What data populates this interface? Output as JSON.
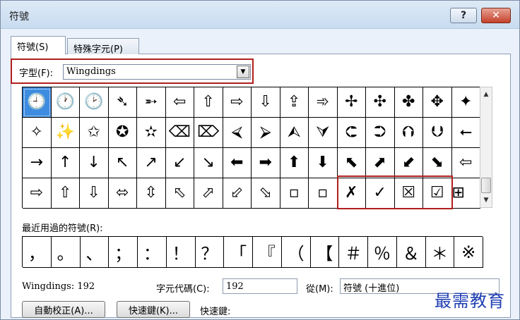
{
  "window": {
    "title": "符號"
  },
  "tabs": [
    {
      "label": "符號(S)"
    },
    {
      "label": "特殊字元(P)"
    }
  ],
  "font": {
    "label": "字型(F):",
    "value": "Wingdings"
  },
  "symbol_grid": {
    "rows": [
      [
        "🕘",
        "🕐",
        "🕑",
        "➴",
        "➵",
        "⇦",
        "⇧",
        "⇨",
        "⇩",
        "⇪",
        "➾",
        "✢",
        "✣",
        "✤",
        "✥",
        "✦"
      ],
      [
        "✧",
        "✨",
        "✩",
        "✪",
        "✫",
        "⌫",
        "⌦",
        "⮘",
        "⮚",
        "⮙",
        "⮛",
        "⮈",
        "⮊",
        "⮉",
        "⮋",
        "⭠"
      ],
      [
        "→",
        "↑",
        "↓",
        "↖",
        "↗",
        "↙",
        "↘",
        "⬅",
        "➡",
        "⬆",
        "⬇",
        "⬉",
        "⬈",
        "⬋",
        "⬊",
        "⇦"
      ],
      [
        "⇨",
        "⇧",
        "⇩",
        "⬄",
        "⇳",
        "⬁",
        "⬀",
        "⬃",
        "⬂",
        "▫",
        "▫",
        "✗",
        "✓",
        "☒",
        "☑",
        "⊞"
      ]
    ],
    "selected": "🕘"
  },
  "recent": {
    "label": "最近用過的符號(R):",
    "symbols": [
      "，",
      "。",
      "、",
      "；",
      "：",
      "！",
      "？",
      "「",
      "『",
      "（",
      "【",
      "＃",
      "％",
      "＆",
      "＊",
      "※"
    ]
  },
  "footer": {
    "font_name": "Wingdings: 192",
    "char_code_label": "字元代碼(C):",
    "char_code_value": "192",
    "from_label": "從(M):",
    "from_value": "符號 (十進位)",
    "autocorrect_button": "自動校正(A)...",
    "shortcut_button": "快速鍵(K)...",
    "shortcut_label": "快速鍵:"
  },
  "watermark": "最需教育"
}
